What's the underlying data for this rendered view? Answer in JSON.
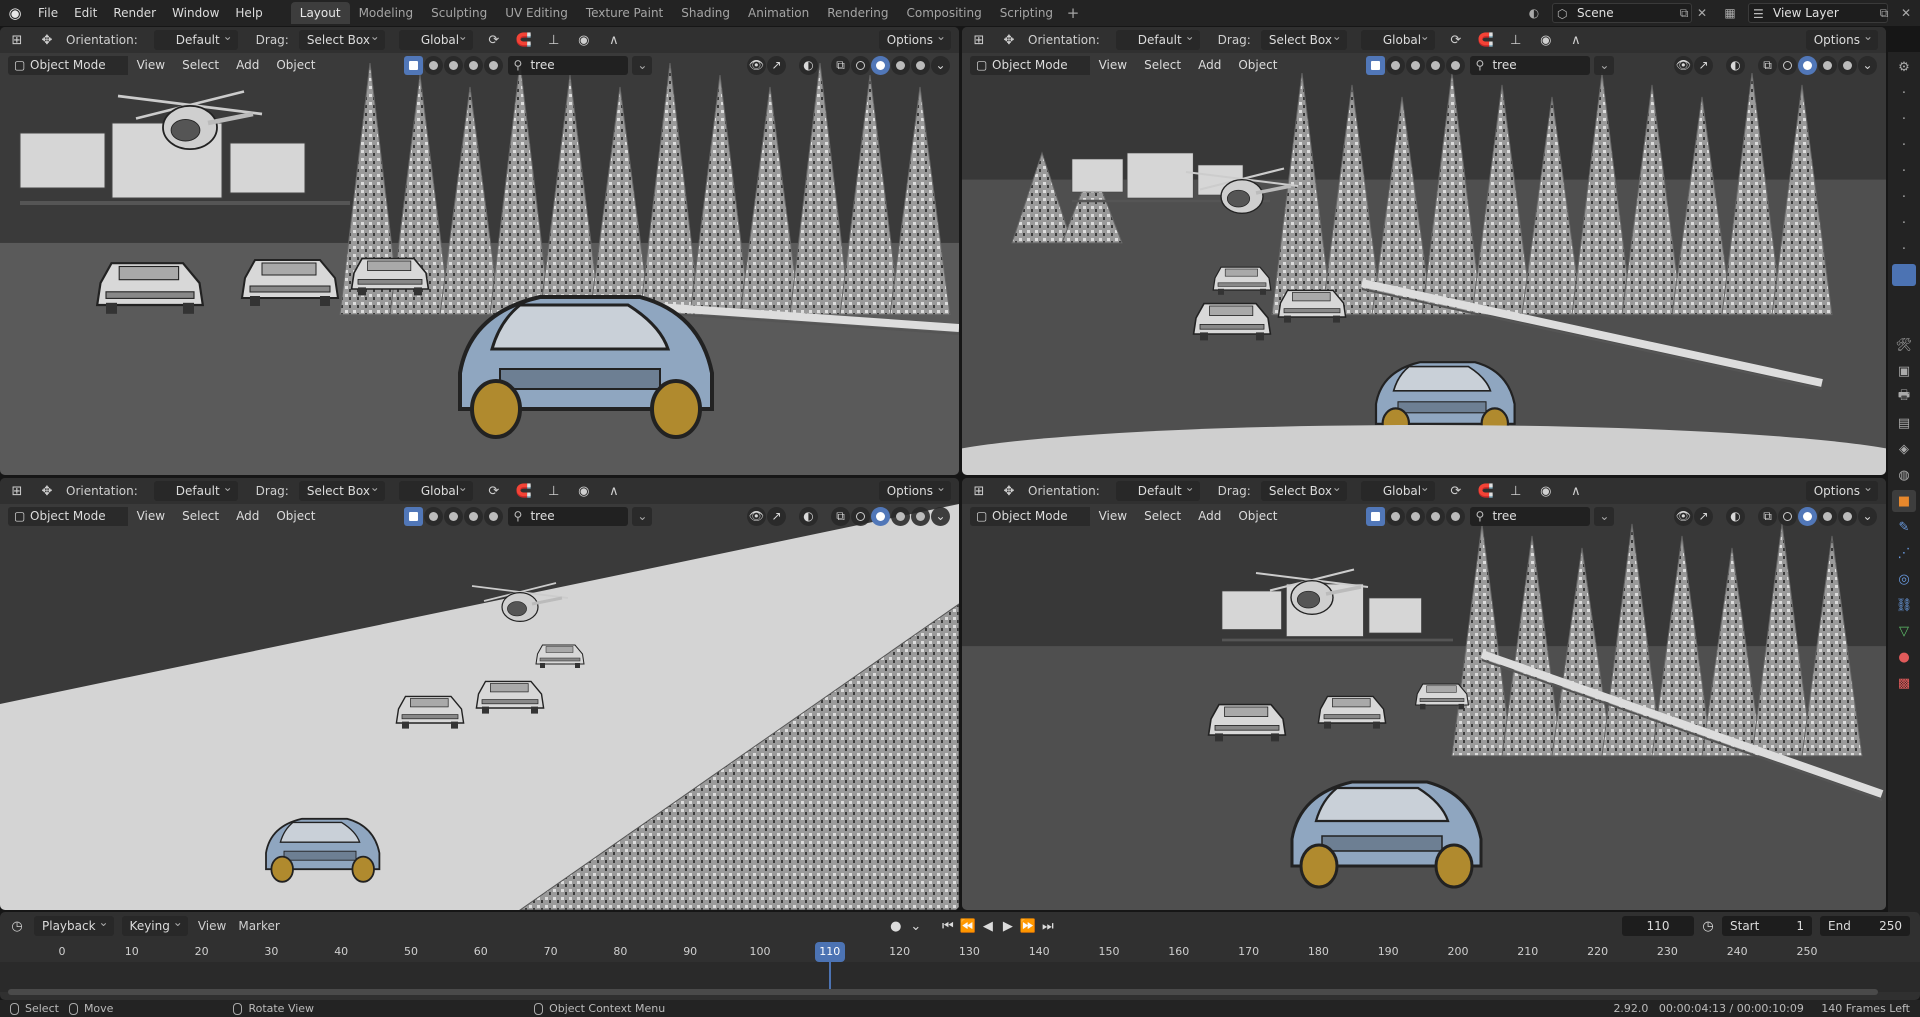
{
  "menu": {
    "items": [
      "File",
      "Edit",
      "Render",
      "Window",
      "Help"
    ]
  },
  "workspaces": {
    "tabs": [
      "Layout",
      "Modeling",
      "Sculpting",
      "UV Editing",
      "Texture Paint",
      "Shading",
      "Animation",
      "Rendering",
      "Compositing",
      "Scripting"
    ],
    "active": "Layout",
    "add": "+"
  },
  "scene": {
    "name": "Scene"
  },
  "view_layer": {
    "name": "View Layer"
  },
  "viewport_header": {
    "orientation_label": "Orientation:",
    "orientation_value": "Default",
    "drag_label": "Drag:",
    "drag_value": "Select Box",
    "transform_value": "Global",
    "options": "Options"
  },
  "viewport_overlay": {
    "mode": "Object Mode",
    "view": "View",
    "select": "Select",
    "add": "Add",
    "object": "Object",
    "search": "tree"
  },
  "timeline": {
    "playback": "Playback",
    "keying": "Keying",
    "view": "View",
    "marker": "Marker",
    "current_frame": "110",
    "start_label": "Start",
    "start_value": "1",
    "end_label": "End",
    "end_value": "250",
    "ticks": [
      "0",
      "10",
      "20",
      "30",
      "40",
      "50",
      "60",
      "70",
      "80",
      "90",
      "100",
      "110",
      "120",
      "130",
      "140",
      "150",
      "160",
      "170",
      "180",
      "190",
      "200",
      "210",
      "220",
      "230",
      "240",
      "250"
    ],
    "playhead": "110"
  },
  "status": {
    "select": "Select",
    "move": "Move",
    "rotate": "Rotate View",
    "context": "Object Context Menu",
    "info": "2.92.0   00:00:04:13 / 00:00:10:09     140 Frames Left"
  },
  "colors": {
    "accent": "#4c73b3",
    "car": "#8fa6c0",
    "ground_dark": "#4a4a4a",
    "trees": "#a7a7a7"
  }
}
